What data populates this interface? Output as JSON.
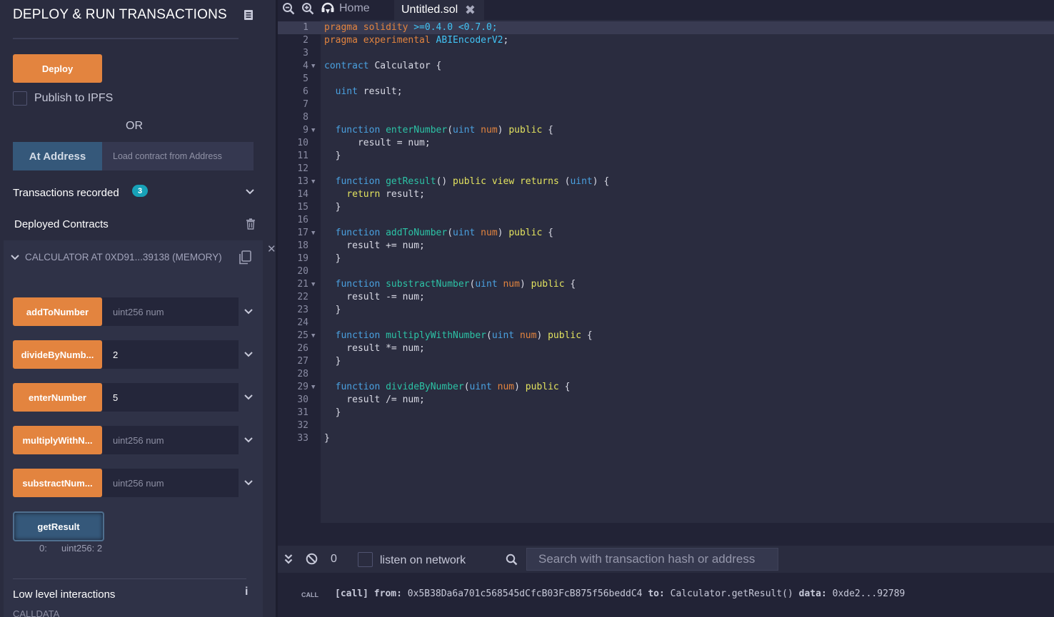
{
  "panel": {
    "title": "DEPLOY & RUN TRANSACTIONS",
    "deploy_label": "Deploy",
    "publish_label": "Publish to IPFS",
    "or_label": "OR",
    "at_address_label": "At Address",
    "at_address_placeholder": "Load contract from Address",
    "transactions_recorded_label": "Transactions recorded",
    "transactions_recorded_count": "3",
    "deployed_contracts_label": "Deployed Contracts",
    "contract_title": "CALCULATOR AT 0XD91...39138 (MEMORY)",
    "functions": [
      {
        "label": "addToNumber",
        "value": "",
        "placeholder": "uint256 num"
      },
      {
        "label": "divideByNumb...",
        "value": "2",
        "placeholder": "uint256 num"
      },
      {
        "label": "enterNumber",
        "value": "5",
        "placeholder": "uint256 num"
      },
      {
        "label": "multiplyWithN...",
        "value": "",
        "placeholder": "uint256 num"
      },
      {
        "label": "substractNum...",
        "value": "",
        "placeholder": "uint256 num"
      }
    ],
    "getresult_label": "getResult",
    "result_index": "0:",
    "result_value": "uint256: 2",
    "low_level_label": "Low level interactions",
    "calldata_label": "CALLDATA"
  },
  "tabs": {
    "home_label": "Home",
    "file_label": "Untitled.sol",
    "close_glyph": "✖"
  },
  "terminal": {
    "pending_count": "0",
    "listen_label": "listen on network",
    "search_placeholder": "Search with transaction hash or address",
    "log_type": "CALL",
    "log_tag": "[call]",
    "log_from_label": "from:",
    "log_from": "0x5B38Da6a701c568545dCfcB03FcB875f56beddC4",
    "log_to_label": "to:",
    "log_to": "Calculator.getResult()",
    "log_data_label": "data:",
    "log_data": "0xde2...92789"
  },
  "colors": {
    "orange_button": "#e3843f",
    "blue_button": "#35587a",
    "badge": "#17a2b8",
    "panel_bg": "#2a2c3f",
    "editor_bg": "#2a2c3f"
  },
  "code": {
    "lines": [
      "pragma solidity >=0.4.0 <0.7.0;",
      "pragma experimental ABIEncoderV2;",
      "",
      "contract Calculator {",
      "",
      "  uint result;",
      "",
      "",
      "  function enterNumber(uint num) public {",
      "      result = num;",
      "  }",
      "",
      "  function getResult() public view returns (uint) {",
      "    return result;",
      "  }",
      "",
      "  function addToNumber(uint num) public {",
      "    result += num;",
      "  }",
      "",
      "  function substractNumber(uint num) public {",
      "    result -= num;",
      "  }",
      "",
      "  function multiplyWithNumber(uint num) public {",
      "    result *= num;",
      "  }",
      "",
      "  function divideByNumber(uint num) public {",
      "    result /= num;",
      "  }",
      "",
      "}"
    ],
    "fold_lines": [
      4,
      9,
      13,
      17,
      21,
      25,
      29
    ],
    "active_line": 1
  }
}
